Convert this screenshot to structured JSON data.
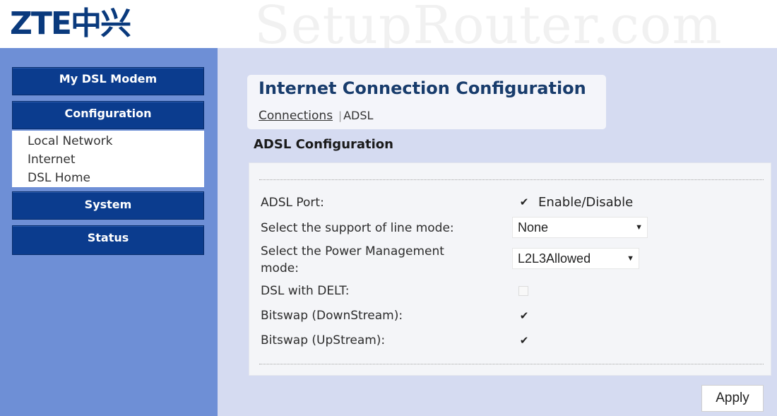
{
  "header": {
    "logo_text": "ZTE中兴",
    "watermark": "SetupRouter.com"
  },
  "sidebar": {
    "my_dsl_modem": "My DSL Modem",
    "configuration": "Configuration",
    "sub_items": [
      "Local Network",
      "Internet",
      "DSL Home"
    ],
    "system": "System",
    "status": "Status"
  },
  "main": {
    "title": "Internet Connection Configuration",
    "breadcrumb": {
      "link": "Connections",
      "separator": "|",
      "current": "ADSL"
    },
    "section_title": "ADSL Configuration",
    "rows": {
      "adsl_port": {
        "label": "ADSL Port:",
        "checked": true,
        "text": "Enable/Disable"
      },
      "line_mode": {
        "label": "Select the support of line mode:",
        "value": "None"
      },
      "power_mode": {
        "label_line1": "Select the Power Management",
        "label_line2": "mode:",
        "value": "L2L3Allowed"
      },
      "delt": {
        "label": "DSL with DELT:",
        "checked": false
      },
      "bitswap_down": {
        "label": "Bitswap (DownStream):",
        "checked": true
      },
      "bitswap_up": {
        "label": "Bitswap (UpStream):",
        "checked": true
      }
    },
    "check_glyph": "✔",
    "caret_glyph": "▼",
    "apply_label": "Apply"
  },
  "colors": {
    "sidebar_bg": "#6e8fd6",
    "nav_button": "#0b3c8e",
    "main_bg": "#d5dbf1",
    "title_color": "#183c6c",
    "logo_color": "#0a3a7d"
  }
}
